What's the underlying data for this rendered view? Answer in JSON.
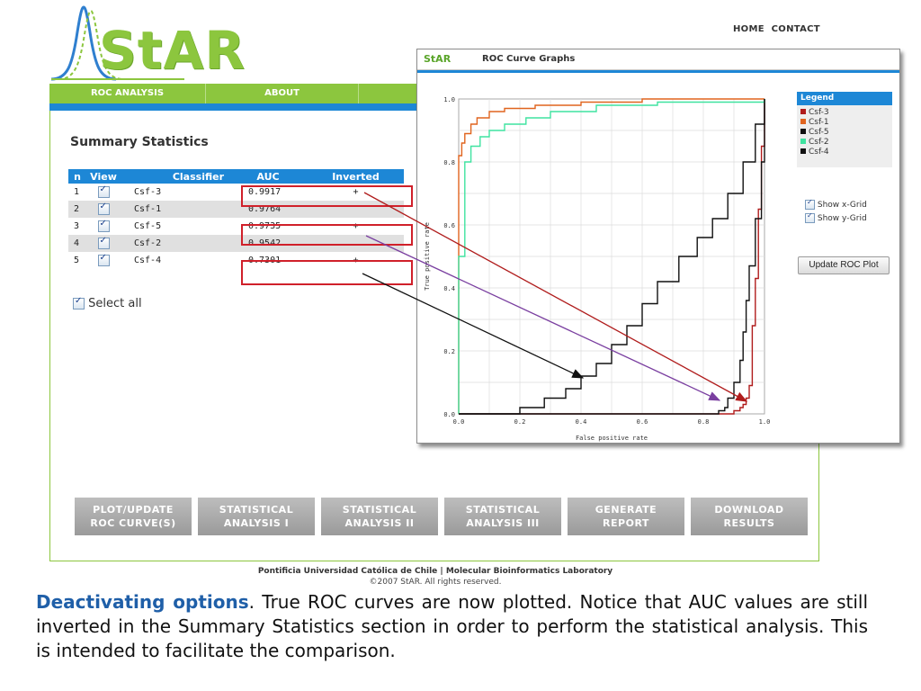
{
  "header": {
    "logo_text": "StAR",
    "top_links": [
      "HOME",
      "CONTACT"
    ]
  },
  "menu": [
    "ROC ANALYSIS",
    "ABOUT"
  ],
  "summary": {
    "title": "Summary Statistics",
    "columns": [
      "n",
      "View",
      "Classifier",
      "AUC",
      "Inverted"
    ],
    "rows": [
      {
        "n": "1",
        "classifier": "Csf-3",
        "auc": "0.9917",
        "inverted": "+"
      },
      {
        "n": "2",
        "classifier": "Csf-1",
        "auc": "0.9764",
        "inverted": ""
      },
      {
        "n": "3",
        "classifier": "Csf-5",
        "auc": "0.9735",
        "inverted": "+"
      },
      {
        "n": "4",
        "classifier": "Csf-2",
        "auc": "0.9542",
        "inverted": ""
      },
      {
        "n": "5",
        "classifier": "Csf-4",
        "auc": "0.7301",
        "inverted": "+"
      }
    ],
    "select_all": "Select all"
  },
  "buttons": [
    {
      "line1": "PLOT/UPDATE",
      "line2": "ROC CURVE(S)"
    },
    {
      "line1": "STATISTICAL",
      "line2": "ANALYSIS I"
    },
    {
      "line1": "STATISTICAL",
      "line2": "ANALYSIS II"
    },
    {
      "line1": "STATISTICAL",
      "line2": "ANALYSIS III"
    },
    {
      "line1": "GENERATE",
      "line2": "REPORT"
    },
    {
      "line1": "DOWNLOAD",
      "line2": "RESULTS"
    }
  ],
  "footer": {
    "line1": "Pontificia Universidad Católica de Chile  |  Molecular Bioinformatics Laboratory",
    "line2": "©2007 StAR. All rights reserved."
  },
  "caption": {
    "bold": "Deactivating options",
    "rest": ". True ROC curves are now plotted. Notice that AUC values are still inverted in the Summary Statistics section in order to perform the statistical analysis. This is intended to facilitate the comparison."
  },
  "popup": {
    "brand": "StAR",
    "title": "ROC Curve Graphs",
    "legend_title": "Legend",
    "legend": [
      {
        "name": "Csf-3",
        "color": "#b01c1c"
      },
      {
        "name": "Csf-1",
        "color": "#e0641e"
      },
      {
        "name": "Csf-5",
        "color": "#111111"
      },
      {
        "name": "Csf-2",
        "color": "#3fe3a0"
      },
      {
        "name": "Csf-4",
        "color": "#111111"
      }
    ],
    "show_x_grid": "Show x-Grid",
    "show_y_grid": "Show y-Grid",
    "update_button": "Update ROC Plot"
  },
  "chart_data": {
    "type": "line",
    "title": "",
    "xlabel": "False positive rate",
    "ylabel": "True positive rate",
    "xlim": [
      0,
      1
    ],
    "ylim": [
      0,
      1
    ],
    "x_ticks": [
      "0.0",
      "0.2",
      "0.4",
      "0.6",
      "0.8",
      "1.0"
    ],
    "y_ticks": [
      "0.0",
      "0.2",
      "0.4",
      "0.6",
      "0.8",
      "1.0"
    ],
    "grid": true,
    "series": [
      {
        "name": "Csf-3",
        "color": "#b01c1c",
        "x": [
          0,
          0.9,
          0.9,
          0.92,
          0.93,
          0.94,
          0.95,
          0.96,
          0.96,
          0.97,
          0.98,
          0.99,
          1.0
        ],
        "y": [
          0,
          0,
          0.01,
          0.02,
          0.03,
          0.05,
          0.09,
          0.16,
          0.28,
          0.43,
          0.65,
          0.85,
          1.0
        ]
      },
      {
        "name": "Csf-1",
        "color": "#e0641e",
        "x": [
          0,
          0,
          0.01,
          0.02,
          0.04,
          0.06,
          0.1,
          0.15,
          0.25,
          0.4,
          0.6,
          0.8,
          1.0
        ],
        "y": [
          0,
          0.82,
          0.86,
          0.89,
          0.92,
          0.94,
          0.96,
          0.97,
          0.98,
          0.99,
          1.0,
          1.0,
          1.0
        ]
      },
      {
        "name": "Csf-5",
        "color": "#111111",
        "x": [
          0,
          0.83,
          0.85,
          0.87,
          0.88,
          0.9,
          0.92,
          0.93,
          0.94,
          0.95,
          0.97,
          0.99,
          1.0
        ],
        "y": [
          0,
          0,
          0.01,
          0.02,
          0.05,
          0.1,
          0.17,
          0.26,
          0.36,
          0.47,
          0.62,
          0.8,
          1.0
        ]
      },
      {
        "name": "Csf-2",
        "color": "#3fe3a0",
        "x": [
          0,
          0,
          0.02,
          0.02,
          0.04,
          0.07,
          0.1,
          0.15,
          0.22,
          0.3,
          0.45,
          0.65,
          1.0
        ],
        "y": [
          0,
          0.5,
          0.55,
          0.8,
          0.85,
          0.88,
          0.9,
          0.92,
          0.94,
          0.96,
          0.98,
          0.99,
          1.0
        ]
      },
      {
        "name": "Csf-4",
        "color": "#111111",
        "x": [
          0,
          0.1,
          0.2,
          0.28,
          0.35,
          0.4,
          0.45,
          0.5,
          0.55,
          0.6,
          0.65,
          0.72,
          0.78,
          0.83,
          0.88,
          0.93,
          0.97,
          1.0
        ],
        "y": [
          0,
          0,
          0.02,
          0.05,
          0.08,
          0.12,
          0.16,
          0.22,
          0.28,
          0.35,
          0.42,
          0.5,
          0.56,
          0.62,
          0.7,
          0.8,
          0.92,
          1.0
        ]
      }
    ]
  }
}
